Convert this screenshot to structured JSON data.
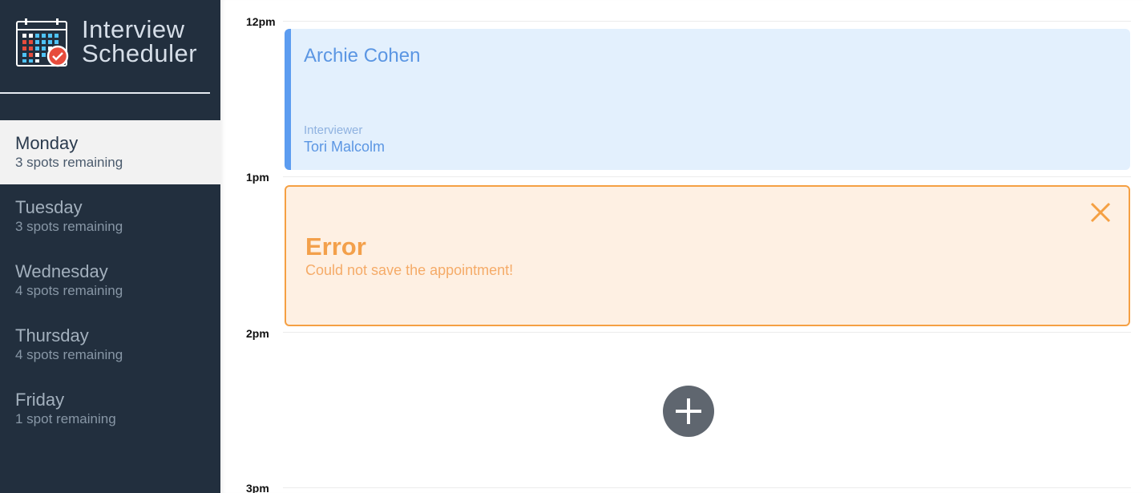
{
  "app": {
    "title_line1": "Interview",
    "title_line2": "Scheduler",
    "logo_icon": "calendar-check-icon"
  },
  "sidebar": {
    "days": [
      {
        "name": "Monday",
        "spots": "3 spots remaining",
        "selected": true
      },
      {
        "name": "Tuesday",
        "spots": "3 spots remaining",
        "selected": false
      },
      {
        "name": "Wednesday",
        "spots": "4 spots remaining",
        "selected": false
      },
      {
        "name": "Thursday",
        "spots": "4 spots remaining",
        "selected": false
      },
      {
        "name": "Friday",
        "spots": "1 spot remaining",
        "selected": false
      }
    ]
  },
  "schedule": {
    "times": [
      "12pm",
      "1pm",
      "2pm",
      "3pm"
    ],
    "appointment": {
      "student": "Archie Cohen",
      "interviewer_label": "Interviewer",
      "interviewer": "Tori Malcolm"
    },
    "error": {
      "title": "Error",
      "message": "Could not save the appointment!",
      "close_icon": "close-icon"
    },
    "add_icon": "plus-icon"
  },
  "colors": {
    "sidebar_bg": "#222f3e",
    "selected_day_bg": "#f2f2f2",
    "appointment_bg": "#e3f0fd",
    "appointment_accent": "#5c9cf0",
    "error_bg": "#fef0e3",
    "error_border": "#f5a043",
    "add_button_bg": "#5f666f"
  }
}
